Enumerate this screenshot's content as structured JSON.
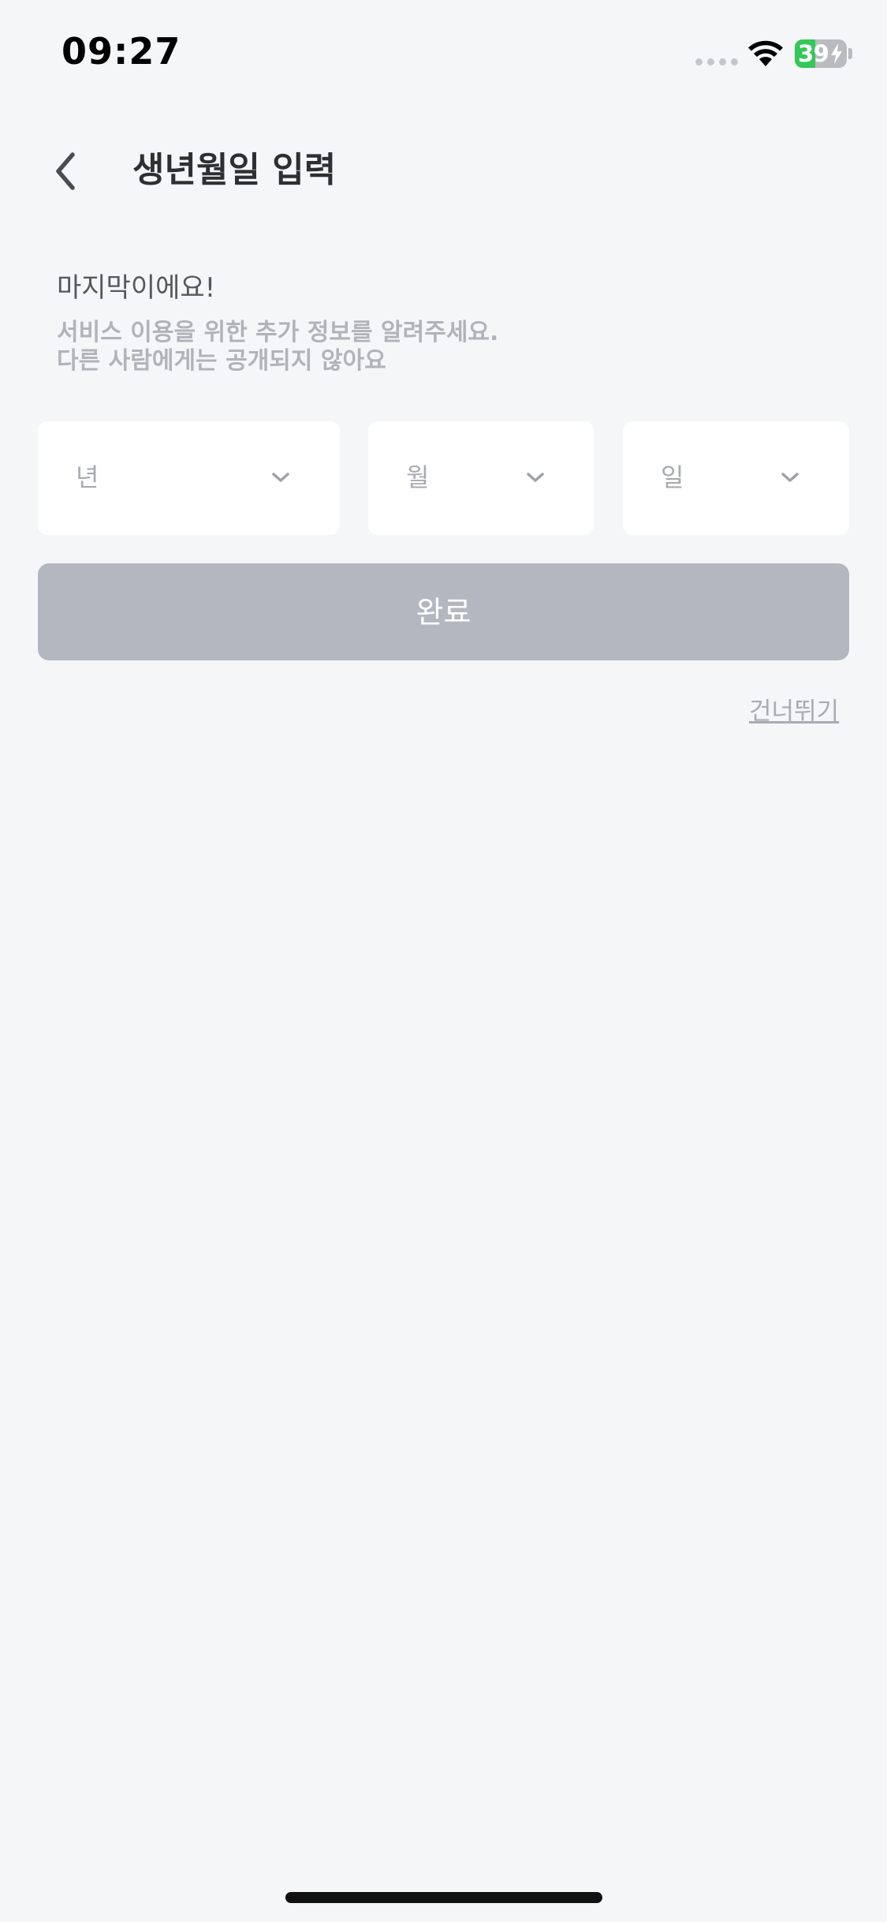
{
  "status_bar": {
    "time": "09:27",
    "battery_level": "39",
    "battery_fraction": 0.39,
    "battery_color": "#34c759",
    "icons": [
      "signal-dots-icon",
      "wifi-icon",
      "battery-icon",
      "charging-bolt-icon"
    ]
  },
  "header": {
    "back_icon": "chevron-left-icon",
    "title": "생년월일 입력"
  },
  "intro": {
    "heading": "마지막이에요!",
    "description_line1": "서비스 이용을 위한 추가 정보를 알려주세요.",
    "description_line2": "다른 사람에게는 공개되지 않아요"
  },
  "selects": {
    "year": {
      "placeholder": "년",
      "icon": "chevron-down-icon"
    },
    "month": {
      "placeholder": "월",
      "icon": "chevron-down-icon"
    },
    "day": {
      "placeholder": "일",
      "icon": "chevron-down-icon"
    }
  },
  "actions": {
    "done_label": "완료",
    "done_color": "#b3b7c0",
    "skip_label": "건너뛰기"
  }
}
